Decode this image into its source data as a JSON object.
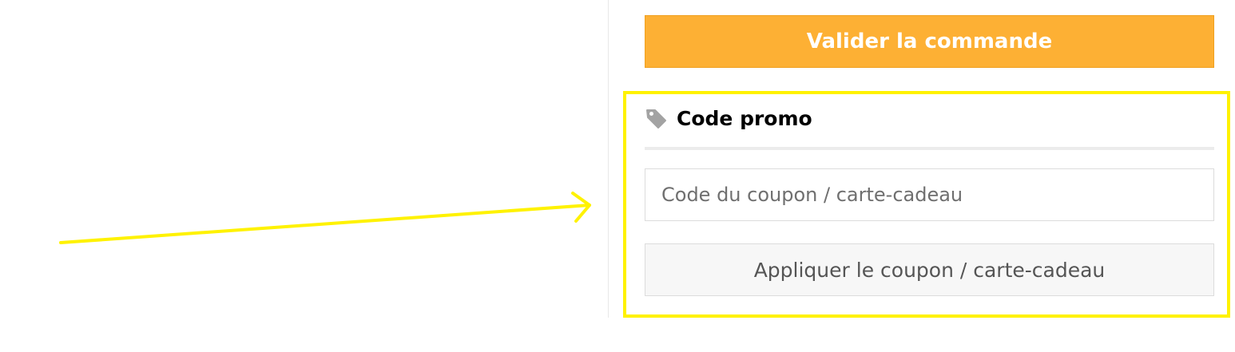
{
  "checkout": {
    "button_label": "Valider la commande",
    "color": "#fdb034"
  },
  "promo": {
    "title": "Code promo",
    "icon": "tag-icon",
    "input_placeholder": "Code du coupon / carte-cadeau",
    "input_value": "",
    "apply_label": "Appliquer le coupon / carte-cadeau"
  },
  "annotation": {
    "highlight_color": "#fff200",
    "arrow_icon": "arrow-right-icon"
  }
}
